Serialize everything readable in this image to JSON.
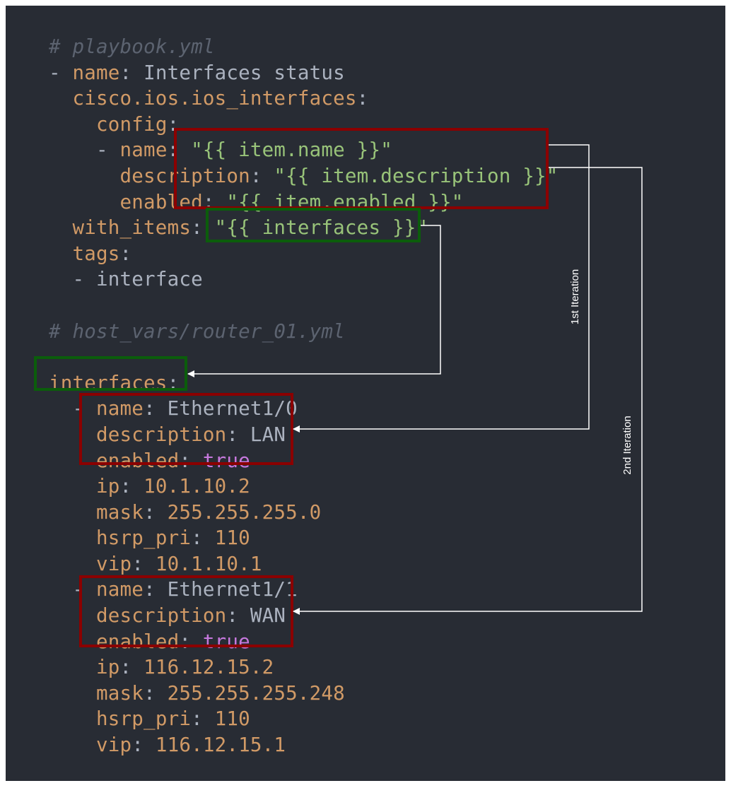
{
  "colors": {
    "background": "#282c34",
    "comment": "#5c6370",
    "key": "#d19a66",
    "string": "#98c379",
    "number": "#d19a66",
    "boolean": "#c678dd",
    "plain": "#abb2bf",
    "box_red": "#8b0000",
    "box_green": "#0b5d0b",
    "arrow": "#ffffff"
  },
  "code_lines": [
    [
      {
        "t": "comment",
        "v": "# playbook.yml"
      }
    ],
    [
      {
        "t": "dash",
        "v": "- "
      },
      {
        "t": "key",
        "v": "name"
      },
      {
        "t": "punct",
        "v": ": "
      },
      {
        "t": "plain",
        "v": "Interfaces status"
      }
    ],
    [
      {
        "t": "plain",
        "v": "  "
      },
      {
        "t": "key",
        "v": "cisco.ios.ios_interfaces"
      },
      {
        "t": "punct",
        "v": ":"
      }
    ],
    [
      {
        "t": "plain",
        "v": "    "
      },
      {
        "t": "key",
        "v": "config"
      },
      {
        "t": "punct",
        "v": ":"
      }
    ],
    [
      {
        "t": "dash",
        "v": "    - "
      },
      {
        "t": "key",
        "v": "name"
      },
      {
        "t": "punct",
        "v": ": "
      },
      {
        "t": "str",
        "v": "\"{{ item.name }}\""
      }
    ],
    [
      {
        "t": "plain",
        "v": "      "
      },
      {
        "t": "key",
        "v": "description"
      },
      {
        "t": "punct",
        "v": ": "
      },
      {
        "t": "str",
        "v": "\"{{ item.description }}\""
      }
    ],
    [
      {
        "t": "plain",
        "v": "      "
      },
      {
        "t": "key",
        "v": "enabled"
      },
      {
        "t": "punct",
        "v": ": "
      },
      {
        "t": "str",
        "v": "\"{{ item.enabled }}\""
      }
    ],
    [
      {
        "t": "plain",
        "v": "  "
      },
      {
        "t": "key",
        "v": "with_items"
      },
      {
        "t": "punct",
        "v": ": "
      },
      {
        "t": "str",
        "v": "\"{{ interfaces }}\""
      }
    ],
    [
      {
        "t": "plain",
        "v": "  "
      },
      {
        "t": "key",
        "v": "tags"
      },
      {
        "t": "punct",
        "v": ":"
      }
    ],
    [
      {
        "t": "dash",
        "v": "  - "
      },
      {
        "t": "plain",
        "v": "interface"
      }
    ],
    [
      {
        "t": "plain",
        "v": ""
      }
    ],
    [
      {
        "t": "comment",
        "v": "# host_vars/router_01.yml"
      }
    ],
    [
      {
        "t": "comment",
        "v": "---"
      }
    ],
    [
      {
        "t": "key",
        "v": "interfaces"
      },
      {
        "t": "punct",
        "v": ":"
      }
    ],
    [
      {
        "t": "dash",
        "v": "  - "
      },
      {
        "t": "key",
        "v": "name"
      },
      {
        "t": "punct",
        "v": ": "
      },
      {
        "t": "plain",
        "v": "Ethernet1/0"
      }
    ],
    [
      {
        "t": "plain",
        "v": "    "
      },
      {
        "t": "key",
        "v": "description"
      },
      {
        "t": "punct",
        "v": ": "
      },
      {
        "t": "plain",
        "v": "LAN"
      }
    ],
    [
      {
        "t": "plain",
        "v": "    "
      },
      {
        "t": "key",
        "v": "enabled"
      },
      {
        "t": "punct",
        "v": ": "
      },
      {
        "t": "bool",
        "v": "true"
      }
    ],
    [
      {
        "t": "plain",
        "v": "    "
      },
      {
        "t": "key",
        "v": "ip"
      },
      {
        "t": "punct",
        "v": ": "
      },
      {
        "t": "num",
        "v": "10.1.10.2"
      }
    ],
    [
      {
        "t": "plain",
        "v": "    "
      },
      {
        "t": "key",
        "v": "mask"
      },
      {
        "t": "punct",
        "v": ": "
      },
      {
        "t": "num",
        "v": "255.255.255.0"
      }
    ],
    [
      {
        "t": "plain",
        "v": "    "
      },
      {
        "t": "key",
        "v": "hsrp_pri"
      },
      {
        "t": "punct",
        "v": ": "
      },
      {
        "t": "num",
        "v": "110"
      }
    ],
    [
      {
        "t": "plain",
        "v": "    "
      },
      {
        "t": "key",
        "v": "vip"
      },
      {
        "t": "punct",
        "v": ": "
      },
      {
        "t": "num",
        "v": "10.1.10.1"
      }
    ],
    [
      {
        "t": "dash",
        "v": "  - "
      },
      {
        "t": "key",
        "v": "name"
      },
      {
        "t": "punct",
        "v": ": "
      },
      {
        "t": "plain",
        "v": "Ethernet1/1"
      }
    ],
    [
      {
        "t": "plain",
        "v": "    "
      },
      {
        "t": "key",
        "v": "description"
      },
      {
        "t": "punct",
        "v": ": "
      },
      {
        "t": "plain",
        "v": "WAN"
      }
    ],
    [
      {
        "t": "plain",
        "v": "    "
      },
      {
        "t": "key",
        "v": "enabled"
      },
      {
        "t": "punct",
        "v": ": "
      },
      {
        "t": "bool",
        "v": "true"
      }
    ],
    [
      {
        "t": "plain",
        "v": "    "
      },
      {
        "t": "key",
        "v": "ip"
      },
      {
        "t": "punct",
        "v": ": "
      },
      {
        "t": "num",
        "v": "116.12.15.2"
      }
    ],
    [
      {
        "t": "plain",
        "v": "    "
      },
      {
        "t": "key",
        "v": "mask"
      },
      {
        "t": "punct",
        "v": ": "
      },
      {
        "t": "num",
        "v": "255.255.255.248"
      }
    ],
    [
      {
        "t": "plain",
        "v": "    "
      },
      {
        "t": "key",
        "v": "hsrp_pri"
      },
      {
        "t": "punct",
        "v": ": "
      },
      {
        "t": "num",
        "v": "110"
      }
    ],
    [
      {
        "t": "plain",
        "v": "    "
      },
      {
        "t": "key",
        "v": "vip"
      },
      {
        "t": "punct",
        "v": ": "
      },
      {
        "t": "num",
        "v": "116.12.15.1"
      }
    ]
  ],
  "annotations": {
    "iteration_1_label": "1st Iteration",
    "iteration_2_label": "2nd Iteration"
  }
}
